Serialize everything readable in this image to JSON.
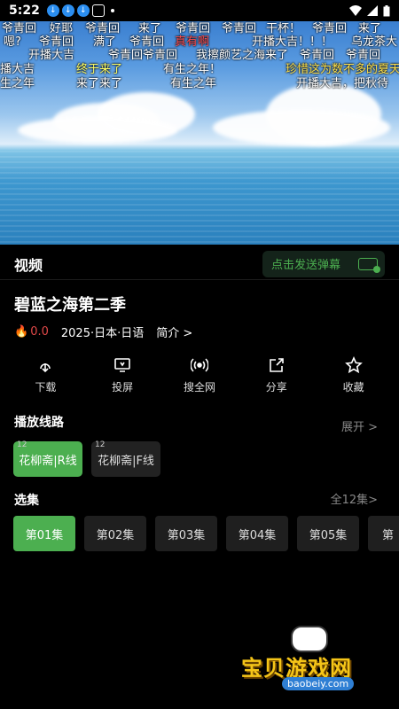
{
  "status_bar": {
    "time": "5:22"
  },
  "video": {
    "danmaku": [
      {
        "text": "爷青回",
        "color": "#ffffff"
      },
      {
        "text": "好耶",
        "color": "#ffffff"
      },
      {
        "text": "爷青回",
        "color": "#ffffff"
      },
      {
        "text": "来了",
        "color": "#ffffff"
      },
      {
        "text": "爷青回",
        "color": "#ffffff"
      },
      {
        "text": "爷青回",
        "color": "#ffffff"
      },
      {
        "text": "干杯！",
        "color": "#ffffff"
      },
      {
        "text": "爷青回",
        "color": "#ffffff"
      },
      {
        "text": "来了",
        "color": "#ffffff"
      },
      {
        "text": "嗯?",
        "color": "#ffffff"
      },
      {
        "text": "爷青回",
        "color": "#ffffff"
      },
      {
        "text": "满了",
        "color": "#ffffff"
      },
      {
        "text": "爷青回",
        "color": "#ffffff"
      },
      {
        "text": "真有啊",
        "color": "#ff4d4d"
      },
      {
        "text": "开播大吉！！！",
        "color": "#ffffff"
      },
      {
        "text": "乌龙茶大",
        "color": "#ffffff"
      },
      {
        "text": "开播大吉",
        "color": "#ffffff"
      },
      {
        "text": "爷青回爷青回",
        "color": "#ffffff"
      },
      {
        "text": "我擦颜艺之海来了",
        "color": "#ffffff"
      },
      {
        "text": "爷青回",
        "color": "#ffffff"
      },
      {
        "text": "爷青回",
        "color": "#ffffff"
      },
      {
        "text": "播大吉",
        "color": "#ffffff"
      },
      {
        "text": "终于来了",
        "color": "#ffff66"
      },
      {
        "text": "有生之年！",
        "color": "#ffffff"
      },
      {
        "text": "珍惜这为数不多的夏天",
        "color": "#ffe24d"
      },
      {
        "text": "生之年",
        "color": "#ffffff"
      },
      {
        "text": "来了来了",
        "color": "#ffffff"
      },
      {
        "text": "有生之年",
        "color": "#ffffff"
      },
      {
        "text": "开播大吉，把秋待",
        "color": "#ffffff"
      }
    ]
  },
  "header": {
    "tab_label": "视频",
    "danmaku_button": "点击发送弹幕"
  },
  "show": {
    "title": "碧蓝之海第二季",
    "rating": "0.0",
    "info": "2025·日本·日语",
    "intro_link": "简介 >"
  },
  "actions": [
    {
      "label": "下载",
      "icon": "download-icon"
    },
    {
      "label": "投屏",
      "icon": "cast-icon"
    },
    {
      "label": "搜全网",
      "icon": "broadcast-icon"
    },
    {
      "label": "分享",
      "icon": "share-icon"
    },
    {
      "label": "收藏",
      "icon": "star-icon"
    }
  ],
  "lines": {
    "title": "播放线路",
    "expand": "展开 >",
    "items": [
      {
        "badge": "12",
        "label": "花柳斋|R线",
        "active": true
      },
      {
        "badge": "12",
        "label": "花柳斋|F线",
        "active": false
      }
    ]
  },
  "episodes": {
    "title": "选集",
    "all": "全12集>",
    "items": [
      "第01集",
      "第02集",
      "第03集",
      "第04集",
      "第05集",
      "第"
    ]
  },
  "watermark": {
    "text": "宝贝游戏网",
    "url": "baobeiy.com"
  },
  "colors": {
    "accent": "#4caf50",
    "background": "#000000"
  }
}
